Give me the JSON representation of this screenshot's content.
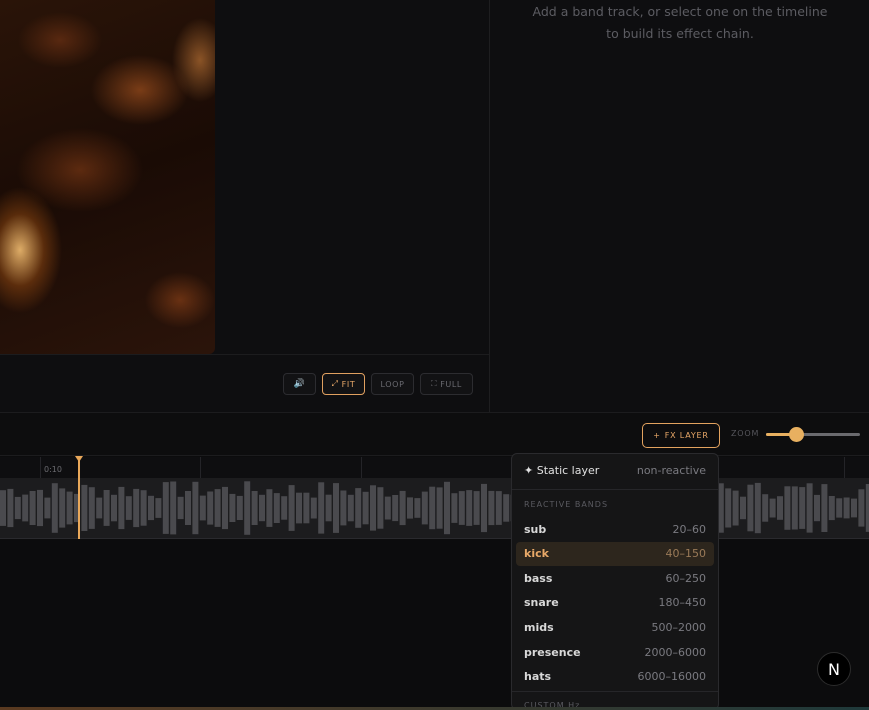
{
  "preview": {
    "buttons": [
      {
        "id": "audio",
        "label": "",
        "icon": "speaker-icon",
        "glyph": "🔊",
        "active": false
      },
      {
        "id": "fit",
        "label": "FIT",
        "icon": "expand-icon",
        "glyph": "⤢",
        "active": true
      },
      {
        "id": "loop",
        "label": "LOOP",
        "icon": "",
        "glyph": "",
        "active": false
      },
      {
        "id": "full",
        "label": "FULL",
        "icon": "fullscreen-icon",
        "glyph": "⛶",
        "active": false
      }
    ]
  },
  "right_panel": {
    "hint": "Add a band track, or select one on the timeline to build its effect chain."
  },
  "toolbar": {
    "fx_layer_label": "FX LAYER",
    "fx_layer_icon_glyph": "+",
    "zoom_label": "ZOOM",
    "zoom_level": 0.3
  },
  "timeline": {
    "ruler_label": "0:10",
    "playhead_color": "#e9a85a"
  },
  "dropdown": {
    "static": {
      "label": "Static layer",
      "glyph": "✦",
      "tag": "non-reactive"
    },
    "reactive_header": "REACTIVE BANDS",
    "bands": [
      {
        "name": "sub",
        "range": "20–60",
        "selected": false
      },
      {
        "name": "kick",
        "range": "40–150",
        "selected": true
      },
      {
        "name": "bass",
        "range": "60–250",
        "selected": false
      },
      {
        "name": "snare",
        "range": "180–450",
        "selected": false
      },
      {
        "name": "mids",
        "range": "500–2000",
        "selected": false
      },
      {
        "name": "presence",
        "range": "2000–6000",
        "selected": false
      },
      {
        "name": "hats",
        "range": "6000–16000",
        "selected": false
      }
    ],
    "custom_header": "CUSTOM Hz"
  },
  "badge": {
    "letter": "N"
  },
  "colors": {
    "accent": "#e8a868",
    "panel": "#151516",
    "background": "#0c0c0d"
  }
}
